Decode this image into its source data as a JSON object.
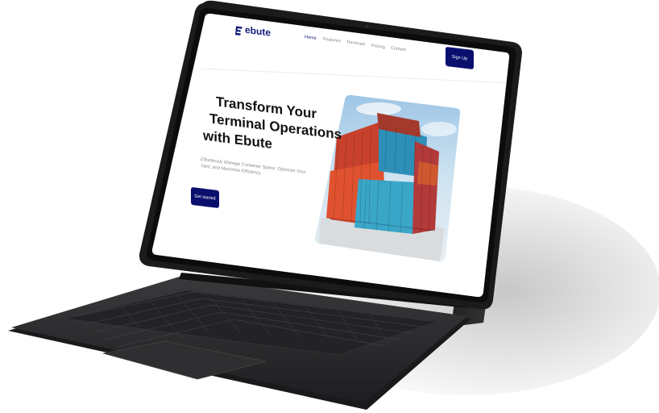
{
  "brand": {
    "name": "ebute"
  },
  "nav": [
    {
      "label": "Home",
      "active": true
    },
    {
      "label": "Features",
      "active": false
    },
    {
      "label": "Terminals",
      "active": false
    },
    {
      "label": "Pricing",
      "active": false
    },
    {
      "label": "Contact",
      "active": false
    }
  ],
  "header": {
    "signup_label": "Sign Up"
  },
  "hero": {
    "title_line1": "Transform Your",
    "title_line2": "Terminal Operations",
    "title_line3": "with Ebute",
    "subtitle_line1": "Effortlessly Manage Container Space, Optimize Your",
    "subtitle_line2": "Yard, and Maximize Efficiency.",
    "cta_label": "Get started"
  },
  "colors": {
    "brand_navy": "#0a0f6e",
    "device_frame": "#1b1b1d",
    "keyboard": "#2a2a2c"
  },
  "icons": [
    "ebute-logo-icon"
  ]
}
